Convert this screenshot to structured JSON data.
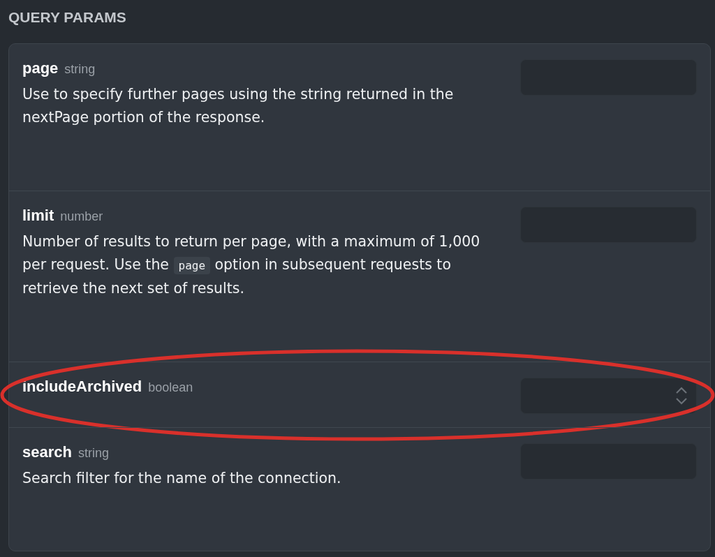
{
  "section_title": "QUERY PARAMS",
  "params": [
    {
      "name": "page",
      "type": "string",
      "kind": "text",
      "highlighted": false,
      "description": [
        {
          "kind": "text",
          "text": "Use to specify further pages using the string returned in the nextPage portion of the response."
        }
      ]
    },
    {
      "name": "limit",
      "type": "number",
      "kind": "text",
      "highlighted": false,
      "description": [
        {
          "kind": "text",
          "text": "Number of results to return per page, with a maximum of 1,000 per request. Use the "
        },
        {
          "kind": "code",
          "text": "page"
        },
        {
          "kind": "text",
          "text": " option in subsequent requests to retrieve the next set of results."
        }
      ]
    },
    {
      "name": "includeArchived",
      "type": "boolean",
      "kind": "select",
      "highlighted": true
    },
    {
      "name": "search",
      "type": "string",
      "kind": "text",
      "highlighted": false,
      "description": [
        {
          "kind": "text",
          "text": "Search filter for the name of the connection."
        }
      ]
    }
  ]
}
